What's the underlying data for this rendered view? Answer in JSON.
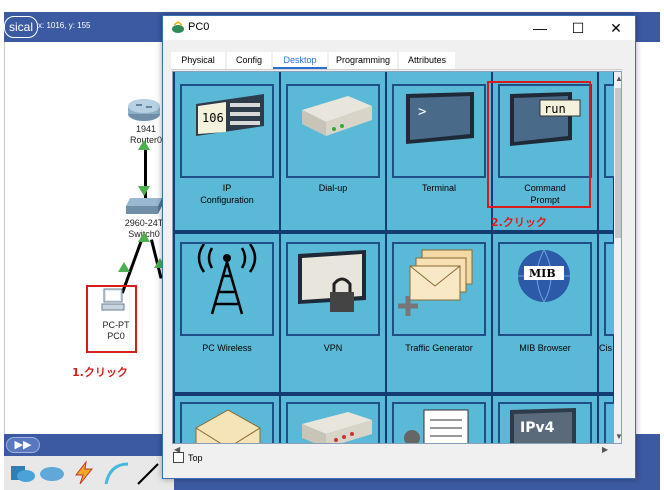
{
  "workspace": {
    "mode_label": "sical",
    "coords": "x: 1016, y: 155",
    "router": {
      "line1": "1941",
      "line2": "Router0"
    },
    "switch": {
      "line1": "2960-24T",
      "line2": "Switch0"
    },
    "pc": {
      "line1": "PC-PT",
      "line2": "PC0"
    },
    "forward_glyph": "▶▶"
  },
  "annotations": {
    "step1": "1.クリック",
    "step2": "2.クリック"
  },
  "window": {
    "title": "PC0",
    "minimize_glyph": "—",
    "maximize_glyph": "☐",
    "close_glyph": "✕",
    "tabs": [
      {
        "label": "Physical"
      },
      {
        "label": "Config"
      },
      {
        "label": "Desktop"
      },
      {
        "label": "Programming"
      },
      {
        "label": "Attributes"
      }
    ],
    "active_tab": "Desktop",
    "tiles": [
      {
        "label_line1": "IP",
        "label_line2": "Configuration",
        "icon": "ip-config-icon",
        "icon_text": "106"
      },
      {
        "label_line1": "Dial-up",
        "label_line2": "",
        "icon": "modem-icon"
      },
      {
        "label_line1": "Terminal",
        "label_line2": "",
        "icon": "terminal-icon",
        "icon_text": ">"
      },
      {
        "label_line1": "Command",
        "label_line2": "Prompt",
        "icon": "command-prompt-icon",
        "icon_text": "run"
      },
      {
        "label_line1": "PC Wireless",
        "label_line2": "",
        "icon": "wireless-antenna-icon"
      },
      {
        "label_line1": "VPN",
        "label_line2": "",
        "icon": "vpn-lock-icon"
      },
      {
        "label_line1": "Traffic Generator",
        "label_line2": "",
        "icon": "traffic-generator-icon"
      },
      {
        "label_line1": "MIB Browser",
        "label_line2": "",
        "icon": "mib-browser-icon",
        "icon_text": "MIB"
      },
      {
        "label_line1": "",
        "label_line2": "",
        "icon": "email-icon"
      },
      {
        "label_line1": "",
        "label_line2": "",
        "icon": "pppoe-icon"
      },
      {
        "label_line1": "",
        "label_line2": "",
        "icon": "text-editor-icon"
      },
      {
        "label_line1": "",
        "label_line2": "",
        "icon": "ipv6-config-icon",
        "icon_text": "IPv4"
      }
    ],
    "partial_label": "Cis",
    "top_checkbox": {
      "label": "Top",
      "checked": false
    }
  },
  "colors": {
    "accent_blue": "#3c5aa2",
    "tile_bg": "#5ab9d6",
    "annotation_red": "#d81b1b",
    "active_tab": "#2b6fd6"
  }
}
